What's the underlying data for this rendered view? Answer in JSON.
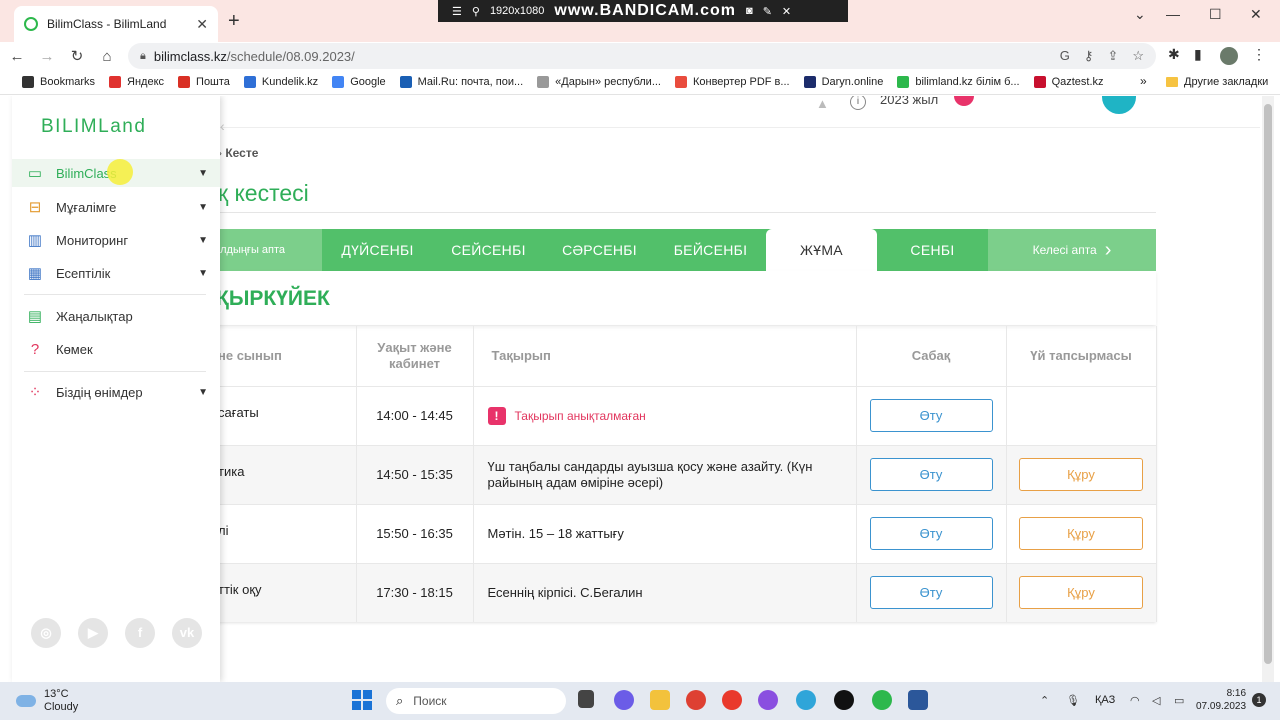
{
  "browser": {
    "tab_title": "BilimClass - BilimLand",
    "recorder": {
      "resolution": "1920x1080",
      "brand": "www.BANDICAM.com"
    },
    "url_host": "bilimclass.kz",
    "url_path": "/schedule/08.09.2023/",
    "bookmarks": [
      {
        "label": "Bookmarks",
        "color": "#333333"
      },
      {
        "label": "Яндекс",
        "color": "#e0322f"
      },
      {
        "label": "Пошта",
        "color": "#d93025"
      },
      {
        "label": "Kundelik.kz",
        "color": "#2f6fd6"
      },
      {
        "label": "Google",
        "color": "#4285f4"
      },
      {
        "label": "Mail.Ru: почта, пои...",
        "color": "#1a5fb4"
      },
      {
        "label": "«Дарын» республи...",
        "color": "#999999"
      },
      {
        "label": "Конвертер PDF в...",
        "color": "#e94c3d"
      },
      {
        "label": "Daryn.online",
        "color": "#1c2c6b"
      },
      {
        "label": "bilimland.kz білім б...",
        "color": "#2db84c"
      },
      {
        "label": "Qaztest.kz",
        "color": "#c8102e"
      }
    ],
    "other_bookmarks": "Другие закладки"
  },
  "header": {
    "year_label": "2023 жыл"
  },
  "sidebar": {
    "logo": "BILIMLand",
    "items": [
      {
        "label": "BilimClass",
        "icon": "monitor-icon",
        "has_children": true,
        "active": true
      },
      {
        "label": "Мұғалімге",
        "icon": "teacher-icon",
        "has_children": true
      },
      {
        "label": "Мониторинг",
        "icon": "chart-icon",
        "has_children": true
      },
      {
        "label": "Есептілік",
        "icon": "table-icon",
        "has_children": true
      },
      {
        "label": "Жаңалықтар",
        "icon": "news-icon",
        "has_children": false
      },
      {
        "label": "Көмек",
        "icon": "help-icon",
        "has_children": false
      },
      {
        "label": "Біздің өнімдер",
        "icon": "products-icon",
        "has_children": true
      }
    ],
    "social": [
      "instagram-icon",
      "youtube-icon",
      "facebook-icon",
      "vk-icon"
    ]
  },
  "breadcrumb": {
    "current": "Кесте"
  },
  "page_title": "қ кестесі",
  "days": {
    "prev_week": "алдыңғы апта",
    "list": [
      "ДҮЙСЕНБІ",
      "СЕЙСЕНБІ",
      "СӘРСЕНБІ",
      "БЕЙСЕНБІ",
      "ЖҰМА",
      "СЕНБІ"
    ],
    "active_index": 4,
    "next_week": "Келесі апта"
  },
  "month": "ҚЫРКҮЙЕК",
  "table": {
    "headers": [
      "не сынып",
      "Уақыт және кабинет",
      "Тақырып",
      "Сабақ",
      "Үй тапсырмасы"
    ],
    "rows": [
      {
        "subject": "сағаты",
        "time": "14:00 - 14:45",
        "topic": "Тақырып анықталмаған",
        "topic_missing": true,
        "lesson_btn": "Өту",
        "homework_btn": ""
      },
      {
        "subject": "тика",
        "time": "14:50 - 15:35",
        "topic": "Үш таңбалы сандарды ауызша қосу және азайту. (Күн райының адам өміріне әсері)",
        "topic_missing": false,
        "lesson_btn": "Өту",
        "homework_btn": "Құру"
      },
      {
        "subject": "лі",
        "time": "15:50 - 16:35",
        "topic": "Мәтін. 15 – 18 жаттығу",
        "topic_missing": false,
        "lesson_btn": "Өту",
        "homework_btn": "Құру"
      },
      {
        "subject": "ттік оқу",
        "time": "17:30 - 18:15",
        "topic": "Есеннің кірпісі. С.Бегалин",
        "topic_missing": false,
        "lesson_btn": "Өту",
        "homework_btn": "Құру"
      }
    ]
  },
  "taskbar": {
    "weather_temp": "13°C",
    "weather_desc": "Cloudy",
    "search_placeholder": "Поиск",
    "language": "ҚАЗ",
    "time": "8:16",
    "date": "07.09.2023",
    "notifications": "1"
  }
}
